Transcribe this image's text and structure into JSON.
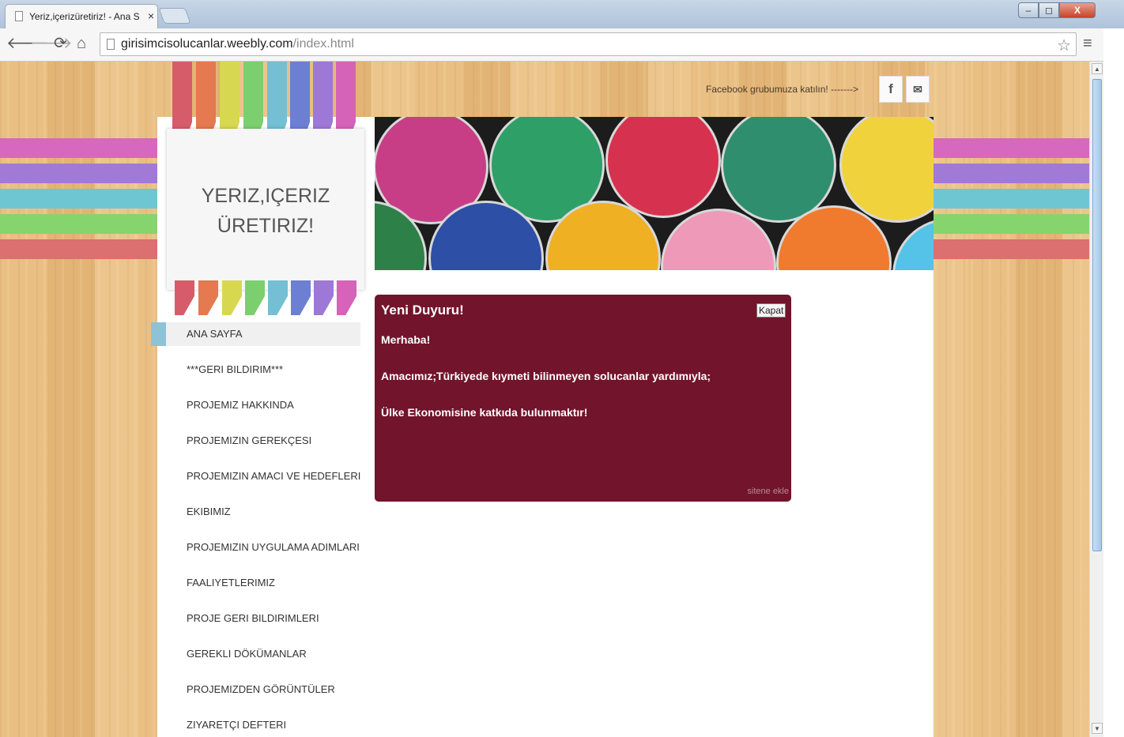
{
  "browser": {
    "tab_title": "Yeriz,içerizüretiriz! - Ana S",
    "tab_close": "×",
    "url_host": "girisimcisolucanlar.weebly.com",
    "url_path": "/index.html",
    "window_buttons": {
      "minimize": "–",
      "maximize": "◻",
      "close": "X"
    },
    "nav_icons": [
      "back-icon",
      "forward-icon",
      "reload-icon",
      "home-icon",
      "bookmark-star-icon",
      "chrome-menu-icon"
    ]
  },
  "site": {
    "facebook_prompt": "Facebook grubumuza katılın! ------->",
    "social": {
      "facebook_glyph": "f",
      "mail_glyph": "✉"
    },
    "title_line1": "YERIZ,IÇERIZ",
    "title_line2": "ÜRETIRIZ!",
    "nav": [
      {
        "label": "ANA SAYFA",
        "active": true
      },
      {
        "label": "***GERI BILDIRIM***"
      },
      {
        "label": "PROJEMIZ HAKKINDA"
      },
      {
        "label": "PROJEMIZIN GEREKÇESI"
      },
      {
        "label": "PROJEMIZIN AMACI VE HEDEFLERI"
      },
      {
        "label": "EKIBIMIZ"
      },
      {
        "label": "PROJEMIZIN UYGULAMA ADIMLARI"
      },
      {
        "label": "FAALIYETLERIMIZ"
      },
      {
        "label": "PROJE GERI BILDIRIMLERI"
      },
      {
        "label": "GEREKLI DÖKÜMANLAR"
      },
      {
        "label": "PROJEMIZDEN GÖRÜNTÜLER"
      },
      {
        "label": "ZIYARETÇI DEFTERI"
      }
    ],
    "announcement": {
      "title": "Yeni Duyuru!",
      "close_label": "Kapat",
      "lines": [
        "Merhaba!",
        "Amacımız;Türkiyede kıymeti bilinmeyen solucanlar yardımıyla;",
        "Ülke Ekonomisine katkıda bulunmaktır!"
      ],
      "footer": "sitene ekle"
    }
  },
  "colors": {
    "announcement_bg": "#72142b",
    "ribbons": [
      "#d75c6a",
      "#e5794f",
      "#d7d84f",
      "#7ccf6f",
      "#74bfd3",
      "#6d7fd3",
      "#9d78d6",
      "#d563b7"
    ],
    "paint": [
      "#c73e86",
      "#2e9f67",
      "#d6324f",
      "#2f8e6e",
      "#f0d33c",
      "#2d4fa6",
      "#f0b024",
      "#ef99b8",
      "#f07a2d",
      "#2d8048",
      "#55c3e7"
    ]
  }
}
